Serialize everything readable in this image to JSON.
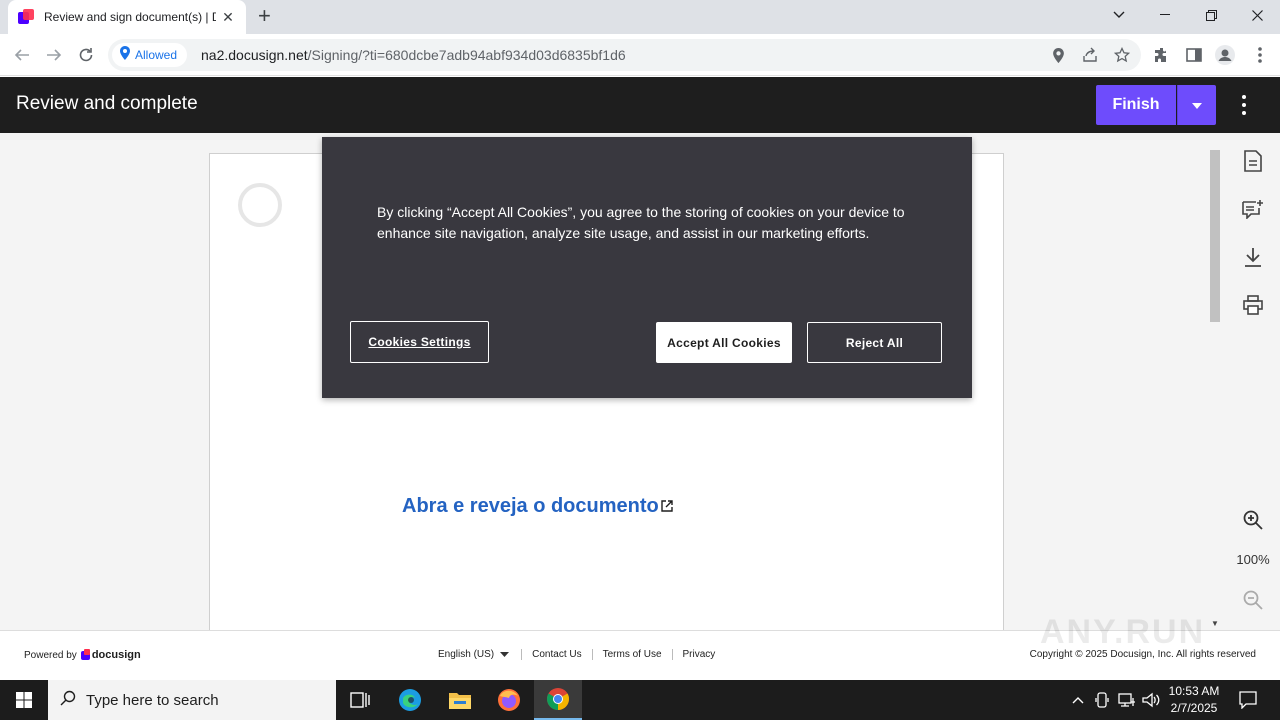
{
  "browser": {
    "tab_title": "Review and sign document(s) | D",
    "tab_close": "✕",
    "new_tab": "+",
    "site_permission": "Allowed",
    "url_host": "na2.docusign.net",
    "url_path": "/Signing/?ti=680dcbe7adb94abf934d03d6835bf1d6"
  },
  "header": {
    "title": "Review and complete",
    "finish_label": "Finish"
  },
  "document": {
    "link_text": "Abra e reveja o documento"
  },
  "side_rail": {
    "zoom_level": "100%"
  },
  "cookie_banner": {
    "message": "By clicking “Accept All Cookies”, you agree to the storing of cookies on your device to enhance site navigation, analyze site usage, and assist in our marketing efforts.",
    "settings_label": "Cookies Settings",
    "accept_label": "Accept All Cookies",
    "reject_label": "Reject All"
  },
  "footer": {
    "powered_by": "Powered by",
    "brand": "docusign",
    "language": "English (US)",
    "links": [
      "Contact Us",
      "Terms of Use",
      "Privacy"
    ],
    "copyright": "Copyright © 2025 Docusign, Inc. All rights reserved",
    "watermark": "ANY.RUN"
  },
  "taskbar": {
    "search_placeholder": "Type here to search",
    "time": "10:53 AM",
    "date": "2/7/2025"
  },
  "colors": {
    "accent": "#6e4cfc",
    "header_bg": "#1e1e1e",
    "cookie_bg": "#39383f",
    "link": "#2463c2"
  }
}
